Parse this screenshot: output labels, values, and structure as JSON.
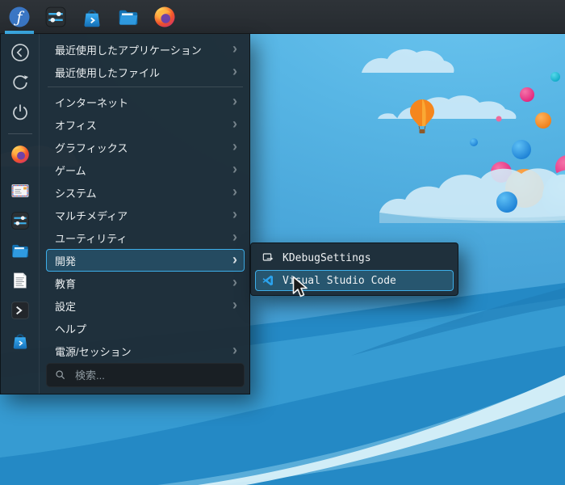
{
  "taskbar": {
    "items": [
      {
        "name": "application-launcher",
        "icon": "fedora-logo",
        "active": true
      },
      {
        "name": "system-settings",
        "icon": "settings-sliders"
      },
      {
        "name": "discover",
        "icon": "discover-bag"
      },
      {
        "name": "file-manager",
        "icon": "folder"
      },
      {
        "name": "firefox",
        "icon": "firefox"
      }
    ]
  },
  "menu": {
    "sidebar_icons": [
      "back",
      "restart",
      "shutdown",
      "firefox",
      "kmail",
      "system-settings",
      "dolphin",
      "text-document",
      "konsole",
      "discover"
    ],
    "items": [
      {
        "label": "最近使用したアプリケーション",
        "submenu": true
      },
      {
        "label": "最近使用したファイル",
        "submenu": true
      },
      {
        "label": "インターネット",
        "submenu": true
      },
      {
        "label": "オフィス",
        "submenu": true
      },
      {
        "label": "グラフィックス",
        "submenu": true
      },
      {
        "label": "ゲーム",
        "submenu": true
      },
      {
        "label": "システム",
        "submenu": true
      },
      {
        "label": "マルチメディア",
        "submenu": true
      },
      {
        "label": "ユーティリティ",
        "submenu": true
      },
      {
        "label": "開発",
        "submenu": true,
        "selected": true
      },
      {
        "label": "教育",
        "submenu": true
      },
      {
        "label": "設定",
        "submenu": true
      },
      {
        "label": "ヘルプ",
        "submenu": false
      },
      {
        "label": "電源/セッション",
        "submenu": true
      }
    ],
    "search_placeholder": "検索..."
  },
  "submenu": {
    "items": [
      {
        "label": "KDebugSettings",
        "icon": "kdebugsettings",
        "selected": false
      },
      {
        "label": "Visual Studio Code",
        "icon": "vscode",
        "selected": true
      }
    ]
  },
  "icons": {
    "chevron_right": "›",
    "fedora_glyph": "ƒ"
  },
  "colors": {
    "accent": "#3daee9",
    "panel_bg": "#262b30",
    "popup_bg": "#1e2c37",
    "selection_border": "#3daee9"
  }
}
